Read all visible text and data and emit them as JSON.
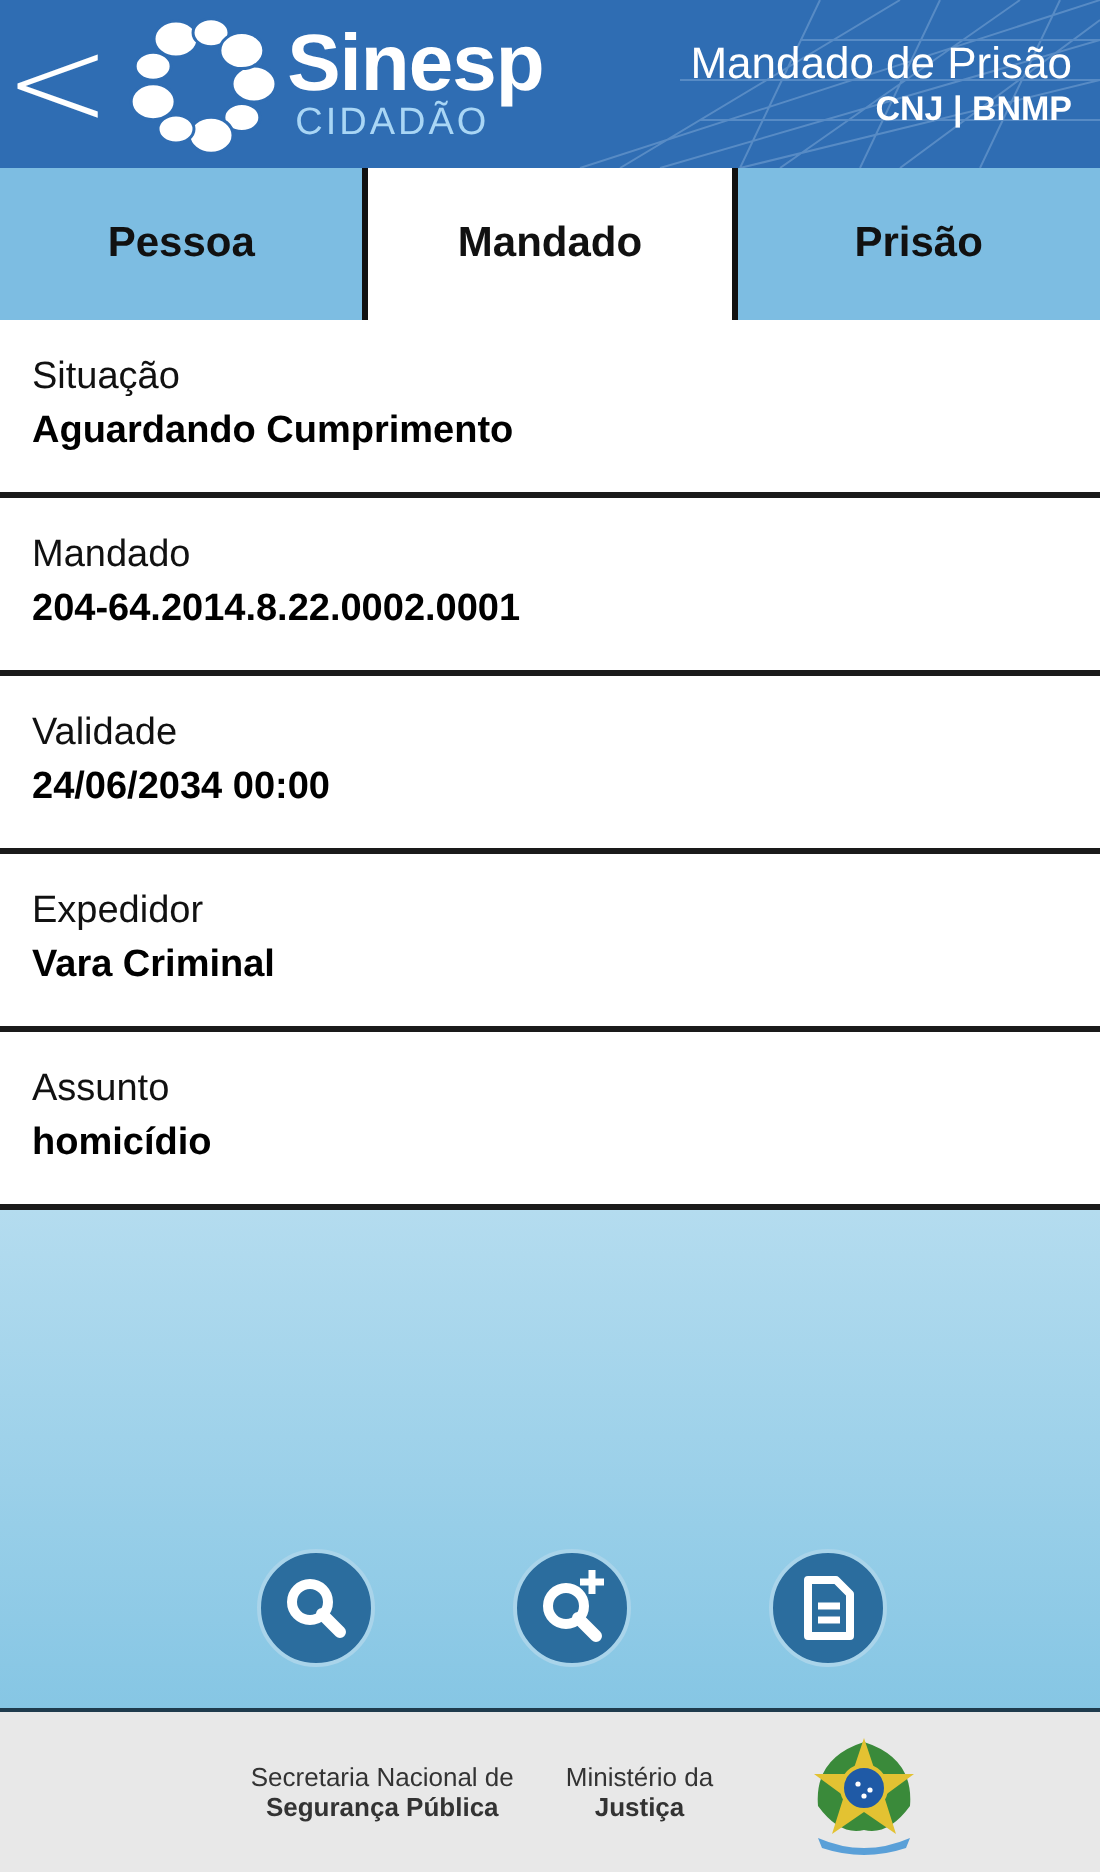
{
  "header": {
    "back": "<",
    "brand": "Sinesp",
    "brand_sub": "CIDADÃO",
    "title": "Mandado de Prisão",
    "subtitle": "CNJ | BNMP"
  },
  "tabs": [
    {
      "label": "Pessoa",
      "selected": false
    },
    {
      "label": "Mandado",
      "selected": true
    },
    {
      "label": "Prisão",
      "selected": false
    }
  ],
  "fields": [
    {
      "label": "Situação",
      "value": "Aguardando Cumprimento"
    },
    {
      "label": "Mandado",
      "value": "204-64.2014.8.22.0002.0001"
    },
    {
      "label": "Validade",
      "value": "24/06/2034 00:00"
    },
    {
      "label": "Expedidor",
      "value": "Vara Criminal"
    },
    {
      "label": "Assunto",
      "value": "homicídio"
    }
  ],
  "actions": [
    {
      "kind": "search"
    },
    {
      "kind": "search-plus"
    },
    {
      "kind": "document"
    }
  ],
  "footer": {
    "secretaria": [
      "Secretaria Nacional de",
      "Segurança Pública"
    ],
    "ministerio": [
      "Ministério da",
      "Justiça"
    ]
  }
}
